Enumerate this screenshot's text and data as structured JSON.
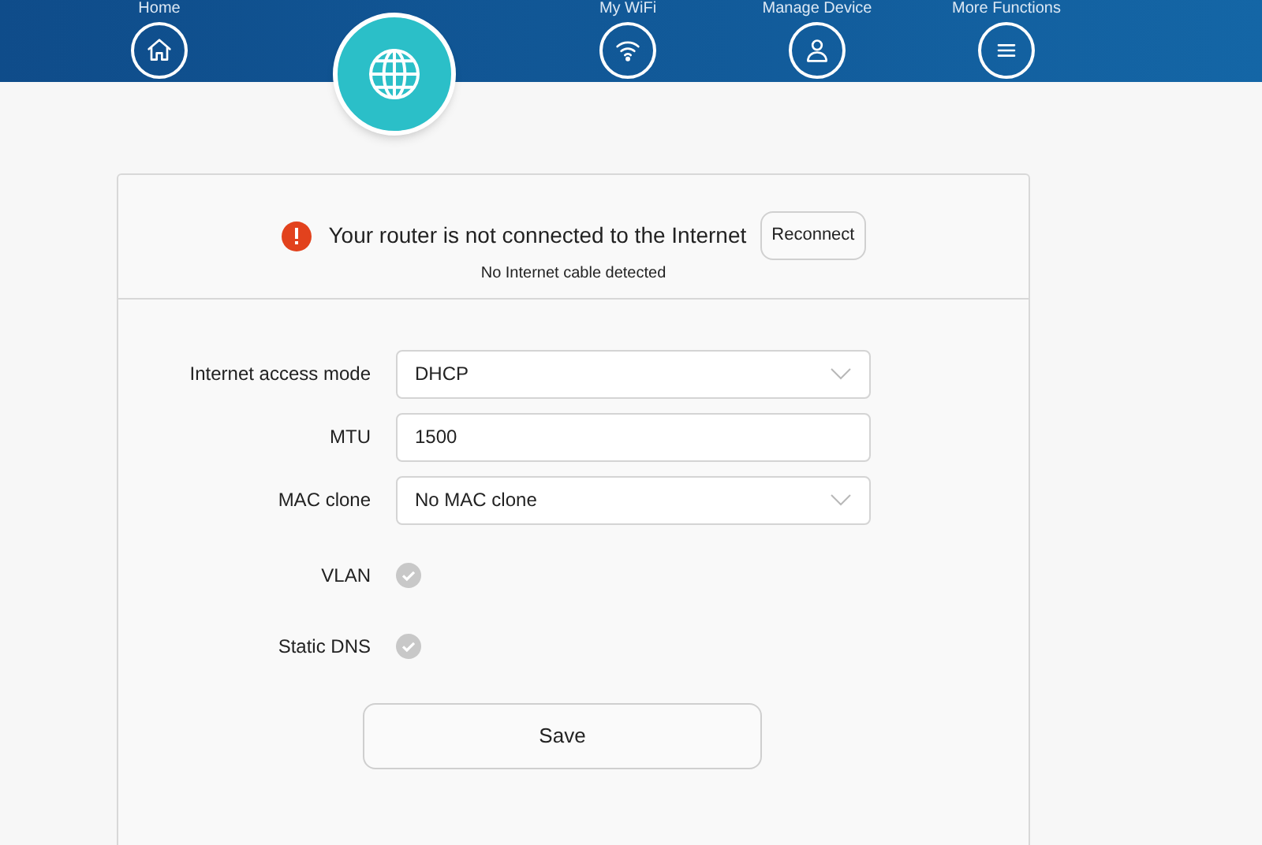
{
  "nav": [
    {
      "label": "Home",
      "kind": "home",
      "selected": false
    },
    {
      "kind": "internet",
      "selected": true
    },
    {
      "label": "My WiFi",
      "kind": "wifi",
      "selected": false
    },
    {
      "label": "Manage Device",
      "kind": "device",
      "selected": false
    },
    {
      "label": "More Functions",
      "kind": "more",
      "selected": false
    }
  ],
  "status": {
    "message": "Your router is not connected to the Internet",
    "detail": "No Internet cable detected",
    "button": "Reconnect"
  },
  "form": [
    {
      "kind": "select",
      "label": "Internet access mode",
      "value": "DHCP"
    },
    {
      "kind": "text",
      "label": "MTU",
      "value": "1500"
    },
    {
      "kind": "select",
      "label": "MAC clone",
      "value": "No MAC clone"
    },
    {
      "kind": "check",
      "label": "VLAN",
      "checked": false
    },
    {
      "kind": "check",
      "label": "Static DNS",
      "checked": false
    }
  ],
  "save_button": "Save"
}
